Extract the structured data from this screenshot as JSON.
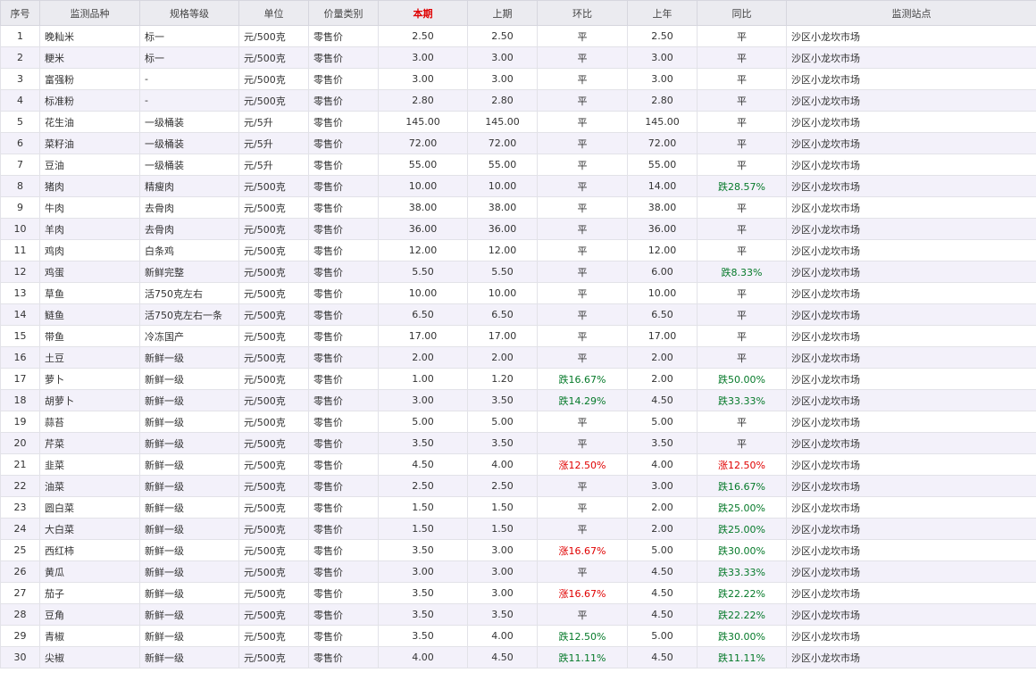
{
  "columns": [
    "序号",
    "监测品种",
    "规格等级",
    "单位",
    "价量类别",
    "本期",
    "上期",
    "环比",
    "上年",
    "同比",
    "监测站点"
  ],
  "highlight_column": "本期",
  "colors": {
    "header_bg": "#ebebf0",
    "highlight_header": "#e00000",
    "row_stripe": "#f3f1fa",
    "down_text": "#067a2a",
    "up_text": "#e00000"
  },
  "rows": [
    {
      "no": "1",
      "item": "晚籼米",
      "spec": "标一",
      "unit": "元/500克",
      "type": "零售价",
      "current": "2.50",
      "prev": "2.50",
      "mom": "平",
      "last_year": "2.50",
      "yoy": "平",
      "site": "沙区小龙坎市场"
    },
    {
      "no": "2",
      "item": "粳米",
      "spec": "标一",
      "unit": "元/500克",
      "type": "零售价",
      "current": "3.00",
      "prev": "3.00",
      "mom": "平",
      "last_year": "3.00",
      "yoy": "平",
      "site": "沙区小龙坎市场"
    },
    {
      "no": "3",
      "item": "富强粉",
      "spec": "-",
      "unit": "元/500克",
      "type": "零售价",
      "current": "3.00",
      "prev": "3.00",
      "mom": "平",
      "last_year": "3.00",
      "yoy": "平",
      "site": "沙区小龙坎市场"
    },
    {
      "no": "4",
      "item": "标准粉",
      "spec": "-",
      "unit": "元/500克",
      "type": "零售价",
      "current": "2.80",
      "prev": "2.80",
      "mom": "平",
      "last_year": "2.80",
      "yoy": "平",
      "site": "沙区小龙坎市场"
    },
    {
      "no": "5",
      "item": "花生油",
      "spec": "一级桶装",
      "unit": "元/5升",
      "type": "零售价",
      "current": "145.00",
      "prev": "145.00",
      "mom": "平",
      "last_year": "145.00",
      "yoy": "平",
      "site": "沙区小龙坎市场"
    },
    {
      "no": "6",
      "item": "菜籽油",
      "spec": "一级桶装",
      "unit": "元/5升",
      "type": "零售价",
      "current": "72.00",
      "prev": "72.00",
      "mom": "平",
      "last_year": "72.00",
      "yoy": "平",
      "site": "沙区小龙坎市场"
    },
    {
      "no": "7",
      "item": "豆油",
      "spec": "一级桶装",
      "unit": "元/5升",
      "type": "零售价",
      "current": "55.00",
      "prev": "55.00",
      "mom": "平",
      "last_year": "55.00",
      "yoy": "平",
      "site": "沙区小龙坎市场"
    },
    {
      "no": "8",
      "item": "猪肉",
      "spec": "精瘦肉",
      "unit": "元/500克",
      "type": "零售价",
      "current": "10.00",
      "prev": "10.00",
      "mom": "平",
      "last_year": "14.00",
      "yoy": "跌28.57%",
      "site": "沙区小龙坎市场"
    },
    {
      "no": "9",
      "item": "牛肉",
      "spec": "去骨肉",
      "unit": "元/500克",
      "type": "零售价",
      "current": "38.00",
      "prev": "38.00",
      "mom": "平",
      "last_year": "38.00",
      "yoy": "平",
      "site": "沙区小龙坎市场"
    },
    {
      "no": "10",
      "item": "羊肉",
      "spec": "去骨肉",
      "unit": "元/500克",
      "type": "零售价",
      "current": "36.00",
      "prev": "36.00",
      "mom": "平",
      "last_year": "36.00",
      "yoy": "平",
      "site": "沙区小龙坎市场"
    },
    {
      "no": "11",
      "item": "鸡肉",
      "spec": "白条鸡",
      "unit": "元/500克",
      "type": "零售价",
      "current": "12.00",
      "prev": "12.00",
      "mom": "平",
      "last_year": "12.00",
      "yoy": "平",
      "site": "沙区小龙坎市场"
    },
    {
      "no": "12",
      "item": "鸡蛋",
      "spec": "新鲜完整",
      "unit": "元/500克",
      "type": "零售价",
      "current": "5.50",
      "prev": "5.50",
      "mom": "平",
      "last_year": "6.00",
      "yoy": "跌8.33%",
      "site": "沙区小龙坎市场"
    },
    {
      "no": "13",
      "item": "草鱼",
      "spec": "活750克左右",
      "unit": "元/500克",
      "type": "零售价",
      "current": "10.00",
      "prev": "10.00",
      "mom": "平",
      "last_year": "10.00",
      "yoy": "平",
      "site": "沙区小龙坎市场"
    },
    {
      "no": "14",
      "item": "鲢鱼",
      "spec": "活750克左右一条",
      "unit": "元/500克",
      "type": "零售价",
      "current": "6.50",
      "prev": "6.50",
      "mom": "平",
      "last_year": "6.50",
      "yoy": "平",
      "site": "沙区小龙坎市场"
    },
    {
      "no": "15",
      "item": "带鱼",
      "spec": "冷冻国产",
      "unit": "元/500克",
      "type": "零售价",
      "current": "17.00",
      "prev": "17.00",
      "mom": "平",
      "last_year": "17.00",
      "yoy": "平",
      "site": "沙区小龙坎市场"
    },
    {
      "no": "16",
      "item": "土豆",
      "spec": "新鲜一级",
      "unit": "元/500克",
      "type": "零售价",
      "current": "2.00",
      "prev": "2.00",
      "mom": "平",
      "last_year": "2.00",
      "yoy": "平",
      "site": "沙区小龙坎市场"
    },
    {
      "no": "17",
      "item": "萝卜",
      "spec": "新鲜一级",
      "unit": "元/500克",
      "type": "零售价",
      "current": "1.00",
      "prev": "1.20",
      "mom": "跌16.67%",
      "last_year": "2.00",
      "yoy": "跌50.00%",
      "site": "沙区小龙坎市场"
    },
    {
      "no": "18",
      "item": "胡萝卜",
      "spec": "新鲜一级",
      "unit": "元/500克",
      "type": "零售价",
      "current": "3.00",
      "prev": "3.50",
      "mom": "跌14.29%",
      "last_year": "4.50",
      "yoy": "跌33.33%",
      "site": "沙区小龙坎市场"
    },
    {
      "no": "19",
      "item": "蒜苔",
      "spec": "新鲜一级",
      "unit": "元/500克",
      "type": "零售价",
      "current": "5.00",
      "prev": "5.00",
      "mom": "平",
      "last_year": "5.00",
      "yoy": "平",
      "site": "沙区小龙坎市场"
    },
    {
      "no": "20",
      "item": "芹菜",
      "spec": "新鲜一级",
      "unit": "元/500克",
      "type": "零售价",
      "current": "3.50",
      "prev": "3.50",
      "mom": "平",
      "last_year": "3.50",
      "yoy": "平",
      "site": "沙区小龙坎市场"
    },
    {
      "no": "21",
      "item": "韭菜",
      "spec": "新鲜一级",
      "unit": "元/500克",
      "type": "零售价",
      "current": "4.50",
      "prev": "4.00",
      "mom": "涨12.50%",
      "last_year": "4.00",
      "yoy": "涨12.50%",
      "site": "沙区小龙坎市场"
    },
    {
      "no": "22",
      "item": "油菜",
      "spec": "新鲜一级",
      "unit": "元/500克",
      "type": "零售价",
      "current": "2.50",
      "prev": "2.50",
      "mom": "平",
      "last_year": "3.00",
      "yoy": "跌16.67%",
      "site": "沙区小龙坎市场"
    },
    {
      "no": "23",
      "item": "圆白菜",
      "spec": "新鲜一级",
      "unit": "元/500克",
      "type": "零售价",
      "current": "1.50",
      "prev": "1.50",
      "mom": "平",
      "last_year": "2.00",
      "yoy": "跌25.00%",
      "site": "沙区小龙坎市场"
    },
    {
      "no": "24",
      "item": "大白菜",
      "spec": "新鲜一级",
      "unit": "元/500克",
      "type": "零售价",
      "current": "1.50",
      "prev": "1.50",
      "mom": "平",
      "last_year": "2.00",
      "yoy": "跌25.00%",
      "site": "沙区小龙坎市场"
    },
    {
      "no": "25",
      "item": "西红柿",
      "spec": "新鲜一级",
      "unit": "元/500克",
      "type": "零售价",
      "current": "3.50",
      "prev": "3.00",
      "mom": "涨16.67%",
      "last_year": "5.00",
      "yoy": "跌30.00%",
      "site": "沙区小龙坎市场"
    },
    {
      "no": "26",
      "item": "黄瓜",
      "spec": "新鲜一级",
      "unit": "元/500克",
      "type": "零售价",
      "current": "3.00",
      "prev": "3.00",
      "mom": "平",
      "last_year": "4.50",
      "yoy": "跌33.33%",
      "site": "沙区小龙坎市场"
    },
    {
      "no": "27",
      "item": "茄子",
      "spec": "新鲜一级",
      "unit": "元/500克",
      "type": "零售价",
      "current": "3.50",
      "prev": "3.00",
      "mom": "涨16.67%",
      "last_year": "4.50",
      "yoy": "跌22.22%",
      "site": "沙区小龙坎市场"
    },
    {
      "no": "28",
      "item": "豆角",
      "spec": "新鲜一级",
      "unit": "元/500克",
      "type": "零售价",
      "current": "3.50",
      "prev": "3.50",
      "mom": "平",
      "last_year": "4.50",
      "yoy": "跌22.22%",
      "site": "沙区小龙坎市场"
    },
    {
      "no": "29",
      "item": "青椒",
      "spec": "新鲜一级",
      "unit": "元/500克",
      "type": "零售价",
      "current": "3.50",
      "prev": "4.00",
      "mom": "跌12.50%",
      "last_year": "5.00",
      "yoy": "跌30.00%",
      "site": "沙区小龙坎市场"
    },
    {
      "no": "30",
      "item": "尖椒",
      "spec": "新鲜一级",
      "unit": "元/500克",
      "type": "零售价",
      "current": "4.00",
      "prev": "4.50",
      "mom": "跌11.11%",
      "last_year": "4.50",
      "yoy": "跌11.11%",
      "site": "沙区小龙坎市场"
    }
  ]
}
